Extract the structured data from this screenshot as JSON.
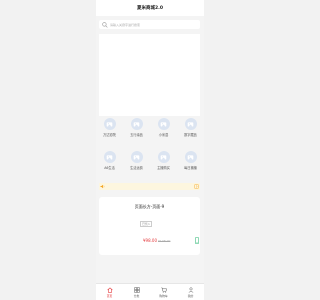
{
  "app": {
    "title": "夏米商城2.0"
  },
  "search": {
    "placeholder": "请输入关键字进行搜索"
  },
  "categories": [
    {
      "label": "万达影院",
      "icon": "image-icon"
    },
    {
      "label": "五行缘品",
      "icon": "image-icon"
    },
    {
      "label": "小米县",
      "icon": "image-icon"
    },
    {
      "label": "数字藏品",
      "icon": "image-icon"
    },
    {
      "label": "A6生活",
      "icon": "image-icon"
    },
    {
      "label": "生活运费",
      "icon": "image-icon"
    },
    {
      "label": "主播购买",
      "icon": "image-icon"
    },
    {
      "label": "每日播播",
      "icon": "image-icon"
    }
  ],
  "product": {
    "title": "页面长方-页面-9",
    "tag": "已售1",
    "price": "¥98.00",
    "original_price": "¥138.00"
  },
  "tabbar": [
    {
      "label": "首页",
      "icon": "home-icon",
      "active": true
    },
    {
      "label": "分类",
      "icon": "category-icon",
      "active": false
    },
    {
      "label": "购物车",
      "icon": "cart-icon",
      "active": false
    },
    {
      "label": "我的",
      "icon": "user-icon",
      "active": false
    }
  ],
  "colors": {
    "accent": "#e4393c",
    "icon_bg": "#dbe4f1",
    "notice_bg": "#fdf6df",
    "notice_icon": "#f5a623"
  }
}
